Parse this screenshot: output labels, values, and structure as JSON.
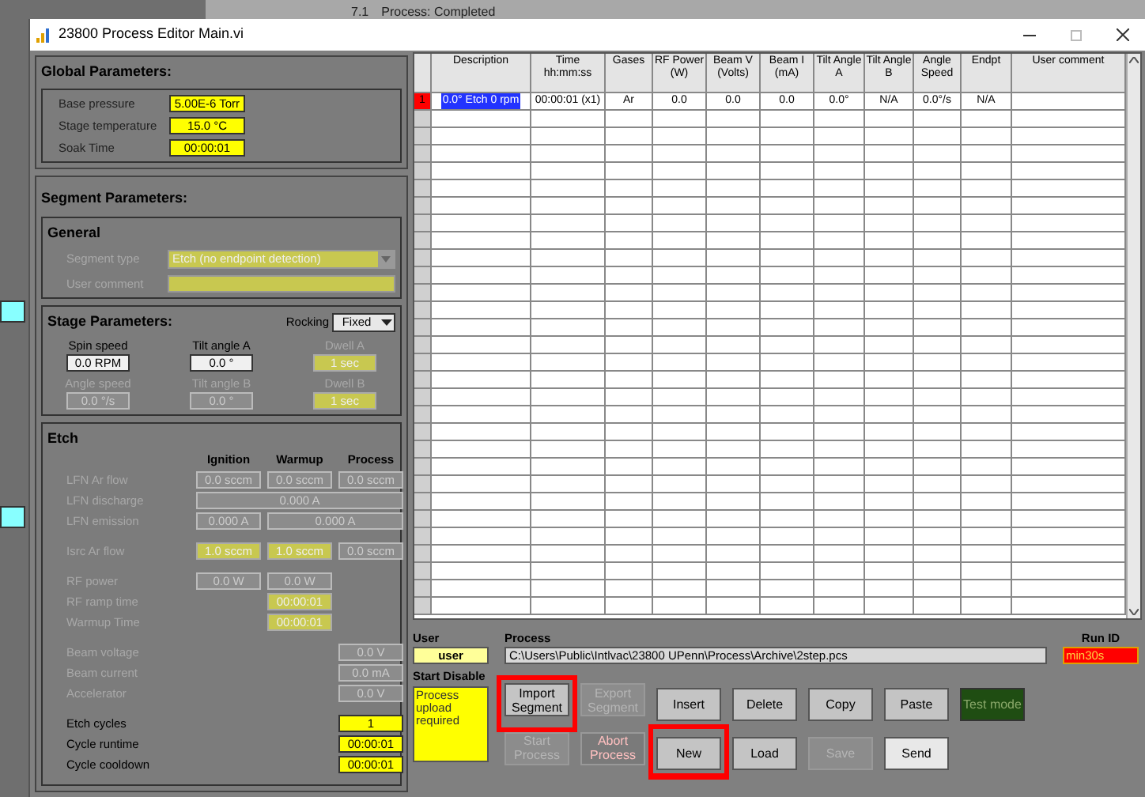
{
  "background": {
    "texts": [
      "7.1",
      "Process: Completed"
    ]
  },
  "window": {
    "title": "23800 Process Editor Main.vi"
  },
  "global": {
    "title": "Global Parameters:",
    "fields": [
      {
        "label": "Base pressure",
        "value": "5.00E-6 Torr"
      },
      {
        "label": "Stage temperature",
        "value": "15.0 °C"
      },
      {
        "label": "Soak Time",
        "value": "00:00:01"
      }
    ]
  },
  "segment": {
    "title": "Segment Parameters:",
    "general": {
      "title": "General",
      "fields": [
        {
          "label": "Segment type",
          "value": "Etch (no endpoint detection)",
          "kind": "dropdown"
        },
        {
          "label": "User comment",
          "kind": "text"
        }
      ]
    },
    "stage": {
      "title": "Stage Parameters:",
      "rocking": {
        "label": "Rocking",
        "value": "Fixed"
      },
      "fields": [
        {
          "label": "Spin speed",
          "value": "0.0 RPM",
          "disabled": false,
          "kind": "white"
        },
        {
          "label": "Tilt angle A",
          "value": "0.0 °",
          "disabled": false,
          "kind": "white"
        },
        {
          "label": "Dwell A",
          "value": "1 sec",
          "disabled": true,
          "kind": "dim-yellow"
        },
        {
          "label": "Angle speed",
          "value": "0.0 °/s",
          "disabled": true,
          "kind": "grey"
        },
        {
          "label": "Tilt angle B",
          "value": "0.0 °",
          "disabled": true,
          "kind": "grey"
        },
        {
          "label": "Dwell B",
          "value": "1 sec",
          "disabled": true,
          "kind": "dim-yellow"
        }
      ]
    },
    "etch": {
      "title": "Etch",
      "columns": [
        "Ignition",
        "Warmup",
        "Process"
      ],
      "rows": [
        {
          "label": "LFN Ar flow",
          "disabled": true,
          "ignition": {
            "value": "0.0 sccm",
            "kind": "grey"
          },
          "warmup": {
            "value": "0.0 sccm",
            "kind": "grey"
          },
          "process": {
            "value": "0.0 sccm",
            "kind": "grey"
          }
        },
        {
          "label": "LFN discharge",
          "disabled": true,
          "ignition_to_process": {
            "value": "0.000 A",
            "kind": "grey"
          }
        },
        {
          "label": "LFN emission",
          "disabled": true,
          "ignition": {
            "value": "0.000 A",
            "kind": "grey"
          },
          "warmup_to_process": {
            "value": "0.000 A",
            "kind": "grey"
          }
        },
        {
          "label": "Isrc Ar flow",
          "disabled": true,
          "ignition": {
            "value": "1.0 sccm",
            "kind": "dim-yellow"
          },
          "warmup": {
            "value": "1.0 sccm",
            "kind": "dim-yellow"
          },
          "process": {
            "value": "0.0 sccm",
            "kind": "grey"
          }
        },
        {
          "label": "RF power",
          "disabled": true,
          "ignition": {
            "value": "0.0 W",
            "kind": "grey"
          },
          "warmup": {
            "value": "0.0 W",
            "kind": "grey"
          }
        },
        {
          "label": "RF ramp time",
          "disabled": true,
          "warmup": {
            "value": "00:00:01",
            "kind": "dim-yellow"
          }
        },
        {
          "label": "Warmup Time",
          "disabled": true,
          "warmup": {
            "value": "00:00:01",
            "kind": "dim-yellow"
          }
        },
        {
          "label": "Beam voltage",
          "disabled": true,
          "process": {
            "value": "0.0 V",
            "kind": "grey"
          }
        },
        {
          "label": "Beam current",
          "disabled": true,
          "process": {
            "value": "0.0 mA",
            "kind": "grey"
          }
        },
        {
          "label": "Accelerator",
          "disabled": true,
          "process": {
            "value": "0.0 V",
            "kind": "grey"
          }
        },
        {
          "label": "Etch cycles",
          "disabled": false,
          "process": {
            "value": "1",
            "kind": "yellow"
          }
        },
        {
          "label": "Cycle runtime",
          "disabled": false,
          "process": {
            "value": "00:00:01",
            "kind": "yellow"
          }
        },
        {
          "label": "Cycle cooldown",
          "disabled": false,
          "process": {
            "value": "00:00:01",
            "kind": "yellow"
          }
        }
      ]
    }
  },
  "table": {
    "columns": [
      "Description",
      "Time hh:mm:ss",
      "Gases",
      "RF Power (W)",
      "Beam V (Volts)",
      "Beam I (mA)",
      "Tilt Angle A",
      "Tilt Angle B",
      "Angle Speed",
      "Endpt",
      "User comment"
    ],
    "rows": [
      {
        "index": "1",
        "selected": true,
        "cells": [
          "0.0° Etch 0 rpm",
          "00:00:01 (x1)",
          "Ar",
          "0.0",
          "0.0",
          "0.0",
          "0.0°",
          "N/A",
          "0.0°/s",
          "N/A",
          null
        ]
      }
    ]
  },
  "user": {
    "label": "User",
    "value": "user"
  },
  "process": {
    "label": "Process",
    "value": "C:\\Users\\Public\\Intlvac\\23800 UPenn\\Process\\Archive\\2step.pcs"
  },
  "run_id": {
    "label": "Run ID",
    "value": "min30s"
  },
  "start_disable": {
    "label": "Start Disable",
    "value": "Process upload required"
  },
  "buttons": [
    [
      {
        "label": "Import Segment",
        "disabled": false,
        "highlighted": true,
        "kind": "normal"
      },
      {
        "label": "Export Segment",
        "disabled": true,
        "highlighted": false,
        "kind": "normal"
      },
      {
        "label": "Insert",
        "disabled": false,
        "highlighted": false,
        "kind": "normal"
      },
      {
        "label": "Delete",
        "disabled": false,
        "highlighted": false,
        "kind": "normal"
      },
      {
        "label": "Copy",
        "disabled": false,
        "highlighted": false,
        "kind": "normal"
      },
      {
        "label": "Paste",
        "disabled": false,
        "highlighted": false,
        "kind": "normal"
      },
      {
        "label": "Test mode",
        "disabled": true,
        "highlighted": false,
        "kind": "indicator"
      }
    ],
    [
      {
        "label": "Start Process",
        "disabled": true,
        "highlighted": false,
        "kind": "normal"
      },
      {
        "label": "Abort Process",
        "disabled": true,
        "highlighted": false,
        "kind": "abort"
      },
      {
        "label": "New",
        "disabled": false,
        "highlighted": true,
        "kind": "normal"
      },
      {
        "label": "Load",
        "disabled": false,
        "highlighted": false,
        "kind": "normal"
      },
      {
        "label": "Save",
        "disabled": true,
        "highlighted": false,
        "kind": "normal"
      },
      {
        "label": "Send",
        "disabled": false,
        "highlighted": false,
        "kind": "light"
      }
    ]
  ]
}
